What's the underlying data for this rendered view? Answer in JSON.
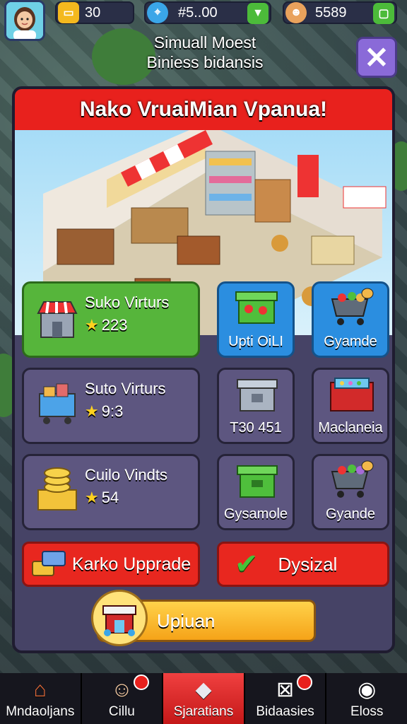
{
  "topbar": {
    "resource1": {
      "value": "30",
      "icon": "ticket-icon"
    },
    "resource2": {
      "value": "#5..00",
      "icon": "location-pin-icon"
    },
    "resource3": {
      "value": "5589",
      "icon": "character-icon"
    }
  },
  "header": {
    "line1": "Simuall Moest",
    "line2": "Biniess bidansis"
  },
  "panel": {
    "title": "Nako VruaiMian Vpanua!",
    "cards": [
      {
        "title": "Suko Virturs",
        "stat": "223"
      },
      {
        "title": "Suto Virturs",
        "stat": "9:3"
      },
      {
        "title": "Cuilo Vindts",
        "stat": "54"
      }
    ],
    "tiles": [
      {
        "label": "Upti OiLI"
      },
      {
        "label": "Gyamde"
      },
      {
        "label": "T30 451"
      },
      {
        "label": "Maclaneia"
      },
      {
        "label": "Gysamole"
      },
      {
        "label": "Gyande"
      }
    ],
    "buttons": {
      "upgrade": "Karko Upprade",
      "confirm": "Dysizal",
      "main": "Upiuan"
    }
  },
  "nav": [
    {
      "label": "Mndaoljans",
      "active": false
    },
    {
      "label": "Cillu",
      "active": false
    },
    {
      "label": "Sjaratians",
      "active": true
    },
    {
      "label": "Bidaasies",
      "active": false
    },
    {
      "label": "Eloss",
      "active": false
    }
  ],
  "colors": {
    "accent_red": "#e8211d",
    "panel": "#464366",
    "green": "#56b53b",
    "blue": "#2b8ee0"
  }
}
